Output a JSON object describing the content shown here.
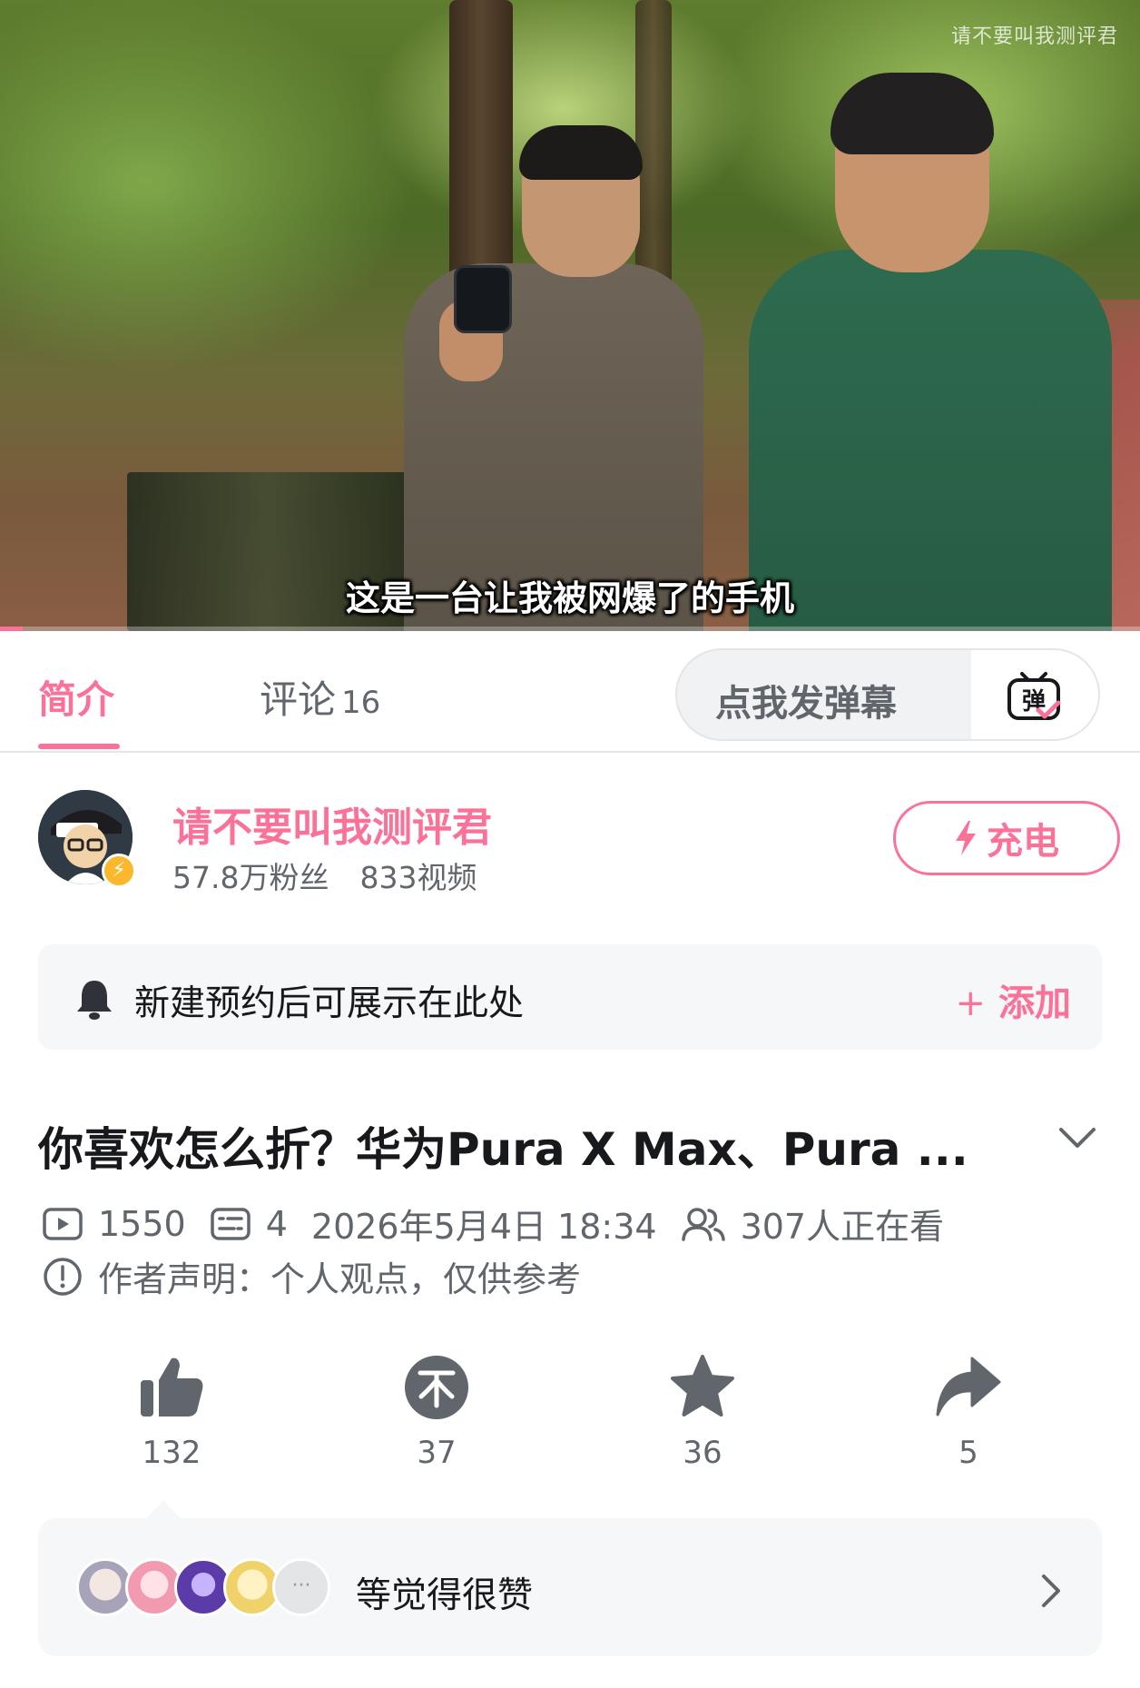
{
  "video": {
    "watermark": "请不要叫我测评君",
    "subtitle": "这是一台让我被网爆了的手机",
    "progress": 0.02
  },
  "tabs": [
    {
      "label": "简介",
      "active": true
    },
    {
      "label": "评论",
      "count": "16",
      "active": false
    }
  ],
  "danmaku": {
    "placeholder": "点我发弹幕",
    "icon": "danmaku-icon"
  },
  "uploader": {
    "name": "请不要叫我测评君",
    "followers": "57.8万粉丝",
    "videos": "833视频",
    "charge_label": "充电"
  },
  "notice": {
    "text": "新建预约后可展示在此处",
    "plus": "+",
    "add_label": "添加"
  },
  "video_info": {
    "title": "你喜欢怎么折？华为Pura X Max、Pura ...",
    "plays": "1550",
    "danmaku_count": "4",
    "datetime": "2026年5月4日 18:34",
    "watching": "307人正在看",
    "declaration": "作者声明：个人观点，仅供参考"
  },
  "actions": {
    "like": "132",
    "coin": "37",
    "favorite": "36",
    "share": "5"
  },
  "likers": {
    "text": "等觉得很赞",
    "more": "···"
  },
  "colors": {
    "accent": "#fb7299",
    "text_primary": "#18191c",
    "text_secondary": "#61666d",
    "icon_gray": "#61666d",
    "panel_bg": "#f6f7f8"
  }
}
